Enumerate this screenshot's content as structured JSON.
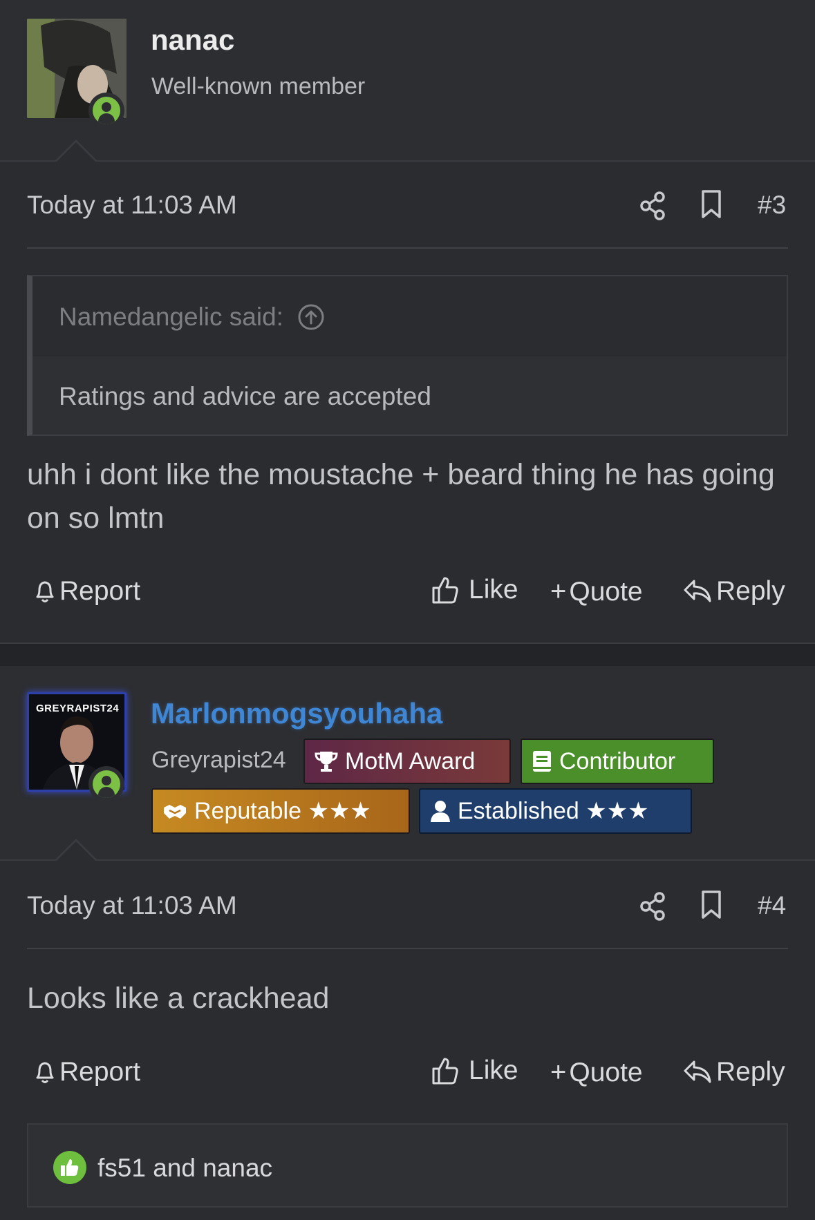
{
  "post3": {
    "username": "nanac",
    "user_title": "Well-known member",
    "time": "Today at 11:03 AM",
    "number": "#3",
    "quote": {
      "author": "Namedangelic said:",
      "text": "Ratings and advice are accepted"
    },
    "message": "uhh i dont like the moustache + beard thing he has going on so lmtn",
    "actions": {
      "report": "Report",
      "like": "Like",
      "quote": "Quote",
      "reply": "Reply"
    }
  },
  "post4": {
    "username": "Marlonmogsyouhaha",
    "avatar_label": "GREYRAPIST24",
    "user_title": "Greyrapist24",
    "badges": [
      {
        "label": "MotM Award",
        "icon": "trophy-icon",
        "color": "#6b2b4a"
      },
      {
        "label": "Contributor",
        "icon": "book-icon",
        "color": "#4b8f2a"
      },
      {
        "label": "Reputable ★★★",
        "icon": "handshake-icon",
        "color": "#c07d1e"
      },
      {
        "label": "Established ★★★",
        "icon": "user-icon",
        "color": "#203e6b"
      }
    ],
    "time": "Today at 11:03 AM",
    "number": "#4",
    "message": "Looks like a crackhead",
    "actions": {
      "report": "Report",
      "like": "Like",
      "quote": "Quote",
      "reply": "Reply"
    },
    "reactions": "fs51 and nanac"
  },
  "colors": {
    "accent_username": "#3f86d4",
    "online": "#7cc046",
    "background": "#2b2c30"
  }
}
